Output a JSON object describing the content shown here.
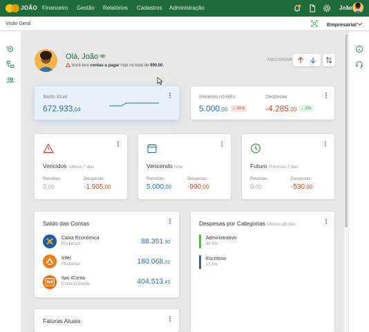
{
  "header": {
    "brand": "JOÃO",
    "nav": [
      "Financeiro",
      "Gestão",
      "Relatórios",
      "Cadastros",
      "Administração"
    ],
    "user": "João",
    "icons": [
      "bell-icon",
      "document-icon",
      "gear-icon"
    ]
  },
  "subbar": {
    "breadcrumb": "Visão Geral",
    "company": "Empresarial"
  },
  "greeting": {
    "title": "Olá, João",
    "warning_prefix": "Você tem",
    "warning_link": "contas a pagar",
    "warning_mid": "hoje no total de",
    "warning_total": "990,00",
    "warning_end": ".",
    "add_label": "ADICIONAR"
  },
  "saldo": {
    "label": "Saldo Atual",
    "value_int": "672.933",
    "value_dec": ",04"
  },
  "mes": {
    "receitas_label": "Receitas no Mês",
    "receitas_int": "5.000",
    "receitas_dec": ",00",
    "despesas_label": "Despesas",
    "despesas_int": "-4.285",
    "despesas_dec": ",00",
    "badge_left": "-31%",
    "badge_right": "-1%"
  },
  "periods": [
    {
      "title": "Vencidos",
      "subtitle": "Últimos 7 dias",
      "rec_label": "Receitas",
      "rec_int": "0",
      "rec_dec": ",00",
      "desp_label": "Despesas",
      "desp_int": "-1.905",
      "desp_dec": ",00"
    },
    {
      "title": "Vencendo",
      "subtitle": "Hoje",
      "rec_label": "Receitas",
      "rec_int": "5.000",
      "rec_dec": ",00",
      "desp_label": "Despesas",
      "desp_int": "-990",
      "desp_dec": ",00"
    },
    {
      "title": "Futuro",
      "subtitle": "Próximos 7 dias",
      "rec_label": "Receitas",
      "rec_int": "0",
      "rec_dec": ",00",
      "desp_label": "Despesas",
      "desp_int": "-530",
      "desp_dec": ",00"
    }
  ],
  "contas": {
    "title": "Saldo das Contas",
    "items": [
      {
        "name": "Caixa Econômica",
        "type": "Poupança",
        "int": "88.351",
        "dec": ",30",
        "color": "#1a5ea8"
      },
      {
        "name": "Inter",
        "type": "Poupança",
        "int": "180.068",
        "dec": ",31",
        "color": "#f07e1b"
      },
      {
        "name": "Itaú iConta",
        "type": "Conta Corrente",
        "int": "404.513",
        "dec": ",43",
        "color": "#ec6b0c",
        "logo_text": "itaú"
      }
    ]
  },
  "categorias": {
    "title": "Despesas por Categorias",
    "subtitle": "Últimos 28 dias",
    "items": [
      {
        "name": "Administrativo",
        "pct": "86,5%",
        "color": "#5cb84a"
      },
      {
        "name": "Escritório",
        "pct": "13,5%",
        "color": "#4a6175"
      }
    ]
  },
  "faturas": {
    "title": "Faturas Atuais"
  },
  "colors": {
    "brand_green": "#1e6b3a",
    "positive_blue": "#2a6fb0",
    "negative_red": "#c0502a"
  }
}
